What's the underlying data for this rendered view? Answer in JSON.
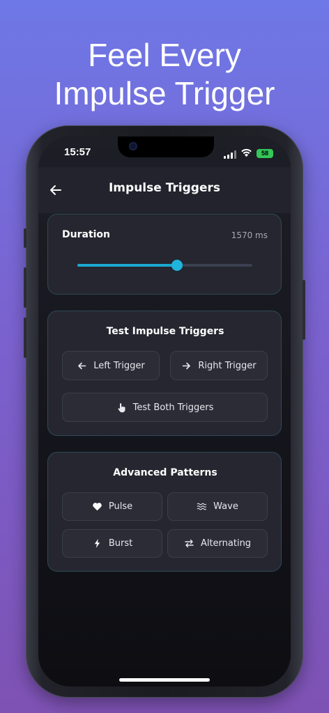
{
  "headline": {
    "line1": "Feel Every",
    "line2": "Impulse Trigger"
  },
  "status_bar": {
    "time": "15:57",
    "battery": "58"
  },
  "nav": {
    "title": "Impulse Triggers",
    "back_icon": "arrow-left-icon"
  },
  "duration": {
    "label": "Duration",
    "value_text": "1570 ms",
    "slider_fraction": 0.57
  },
  "test_triggers": {
    "title": "Test Impulse Triggers",
    "left": {
      "label": "Left Trigger",
      "icon": "arrow-left-icon"
    },
    "right": {
      "label": "Right Trigger",
      "icon": "arrow-right-icon"
    },
    "both": {
      "label": "Test Both Triggers",
      "icon": "hand-pointer-icon"
    }
  },
  "advanced": {
    "title": "Advanced Patterns",
    "pulse": {
      "label": "Pulse",
      "icon": "heart-icon"
    },
    "wave": {
      "label": "Wave",
      "icon": "wave-icon"
    },
    "burst": {
      "label": "Burst",
      "icon": "lightning-icon"
    },
    "alternating": {
      "label": "Alternating",
      "icon": "swap-arrows-icon"
    }
  },
  "colors": {
    "accent": "#1aa8cf",
    "card_border": "#2f4a57",
    "battery": "#34c759"
  }
}
